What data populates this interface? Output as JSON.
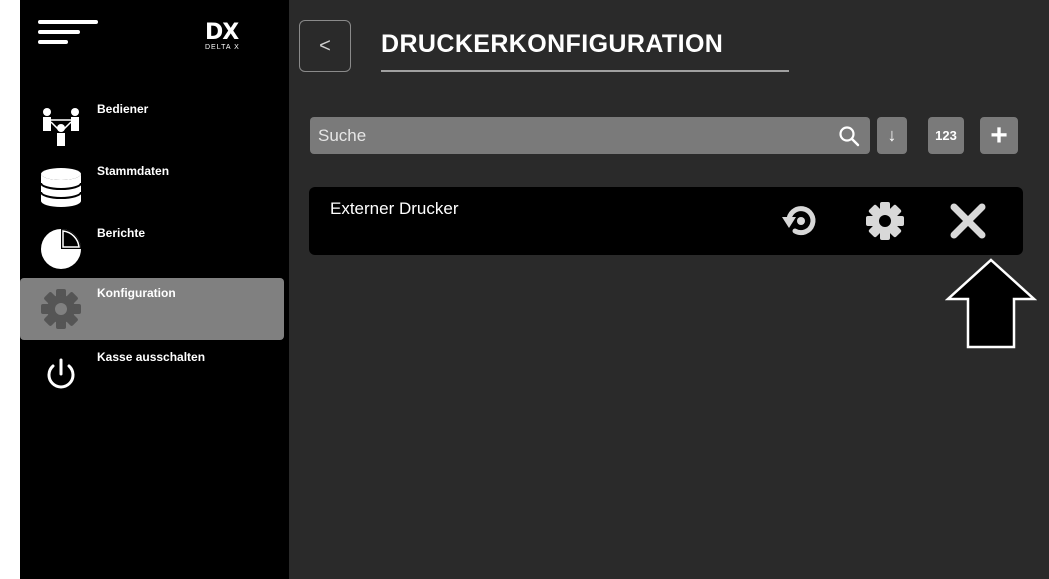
{
  "sidebar": {
    "menu_icon": "hamburger-menu-icon",
    "logo": {
      "mark": "DX",
      "text": "DELTA X"
    },
    "items": [
      {
        "label": "Bediener",
        "icon": "users-icon",
        "active": false
      },
      {
        "label": "Stammdaten",
        "icon": "database-icon",
        "active": false
      },
      {
        "label": "Berichte",
        "icon": "pie-chart-icon",
        "active": false
      },
      {
        "label": "Konfiguration",
        "icon": "gear-icon",
        "active": true
      },
      {
        "label": "Kasse ausschalten",
        "icon": "power-icon",
        "active": false
      }
    ]
  },
  "header": {
    "back_label": "<",
    "title": "DRUCKERKONFIGURATION"
  },
  "toolbar": {
    "search_placeholder": "Suche",
    "search_value": "",
    "sort_label": "↓",
    "numeric_label": "123",
    "add_label": "+"
  },
  "printers": [
    {
      "name": "Externer Drucker",
      "actions": [
        "reset-icon",
        "settings-icon",
        "delete-icon"
      ]
    }
  ],
  "annotation": {
    "icon": "outline-up-arrow-icon"
  },
  "colors": {
    "sidebar_bg": "#000000",
    "main_bg": "#2a2a2a",
    "active_item_bg": "#808080",
    "control_bg": "#7a7a7a",
    "text": "#ffffff"
  }
}
